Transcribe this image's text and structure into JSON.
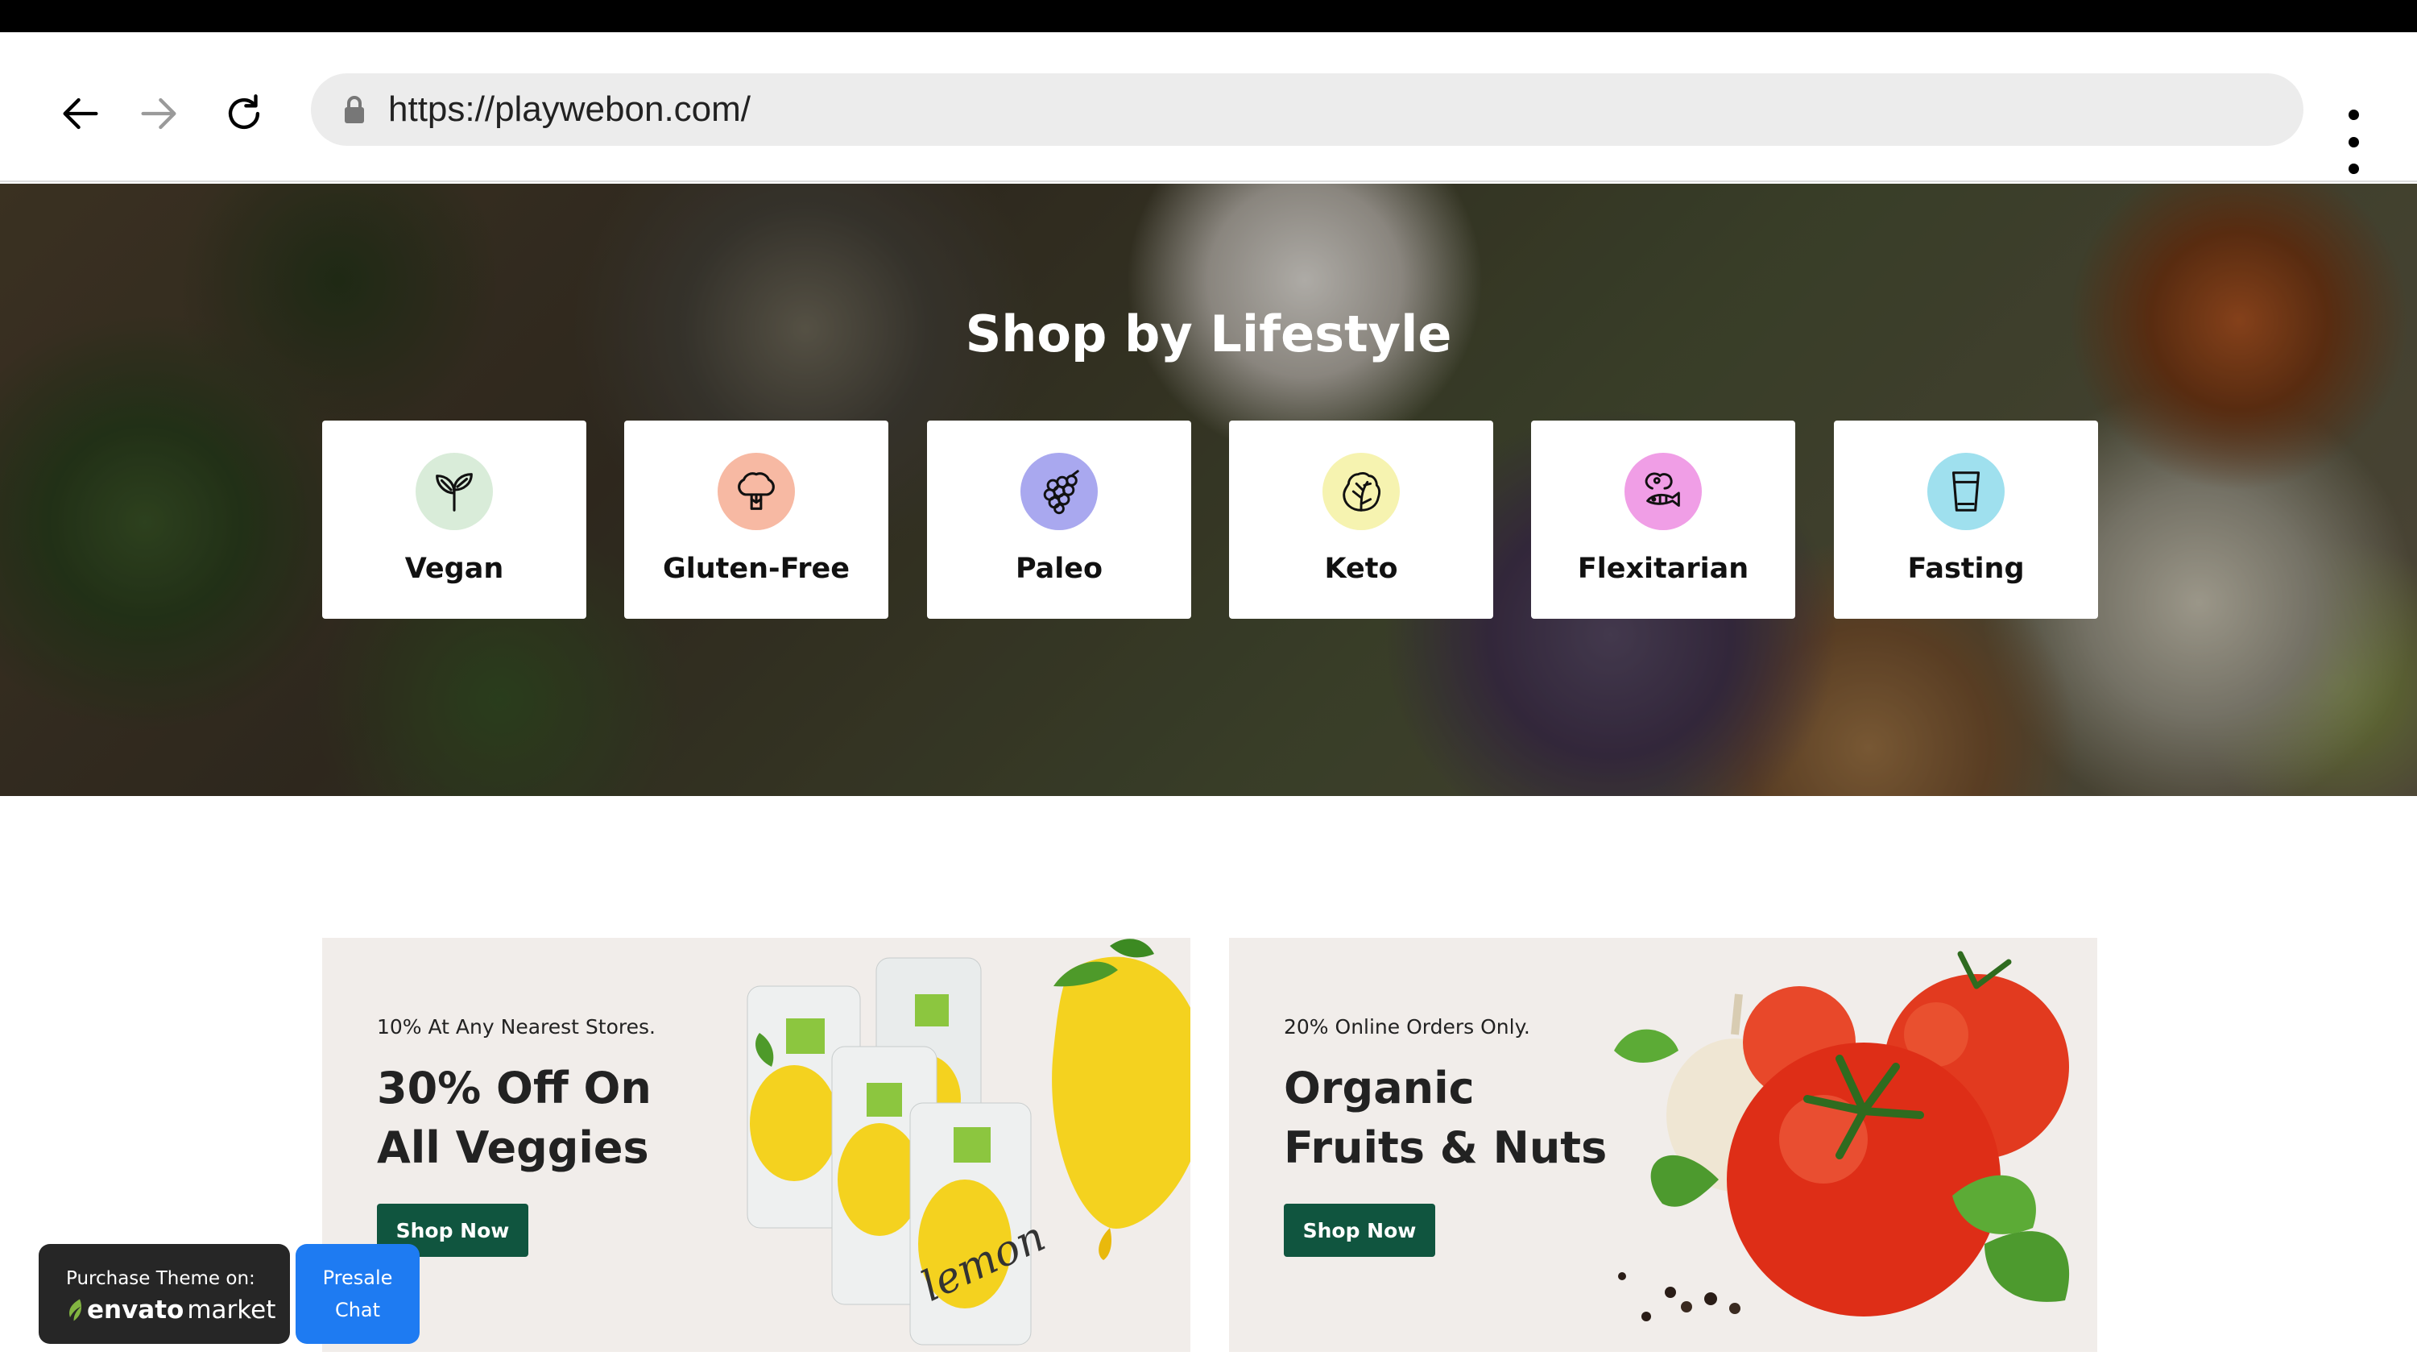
{
  "browser": {
    "url": "https://playwebon.com/",
    "icons": [
      "back-arrow-icon",
      "forward-arrow-icon",
      "reload-icon",
      "lock-icon",
      "more-vert-icon"
    ]
  },
  "hero": {
    "title": "Shop by Lifestyle",
    "categories": [
      {
        "label": "Vegan",
        "icon": "sprout-icon",
        "color": "#d9ecd9"
      },
      {
        "label": "Gluten-Free",
        "icon": "broccoli-icon",
        "color": "#f7b9a3"
      },
      {
        "label": "Paleo",
        "icon": "grapes-icon",
        "color": "#a9a8ef"
      },
      {
        "label": "Keto",
        "icon": "lettuce-icon",
        "color": "#f6f3b0"
      },
      {
        "label": "Flexitarian",
        "icon": "meat-fish-icon",
        "color": "#f09ee6"
      },
      {
        "label": "Fasting",
        "icon": "glass-icon",
        "color": "#9fe0ee"
      }
    ]
  },
  "banners": [
    {
      "small": "10% At Any Nearest Stores.",
      "title_line1": "30% Off On",
      "title_line2": "All Veggies",
      "button": "Shop Now",
      "art": "lemon-juice-cans"
    },
    {
      "small": "20% Online Orders Only.",
      "title_line1": "Organic",
      "title_line2": "Fruits & Nuts",
      "button": "Shop Now",
      "art": "tomatoes-garlic-basil"
    }
  ],
  "purchase": {
    "label": "Purchase Theme on:",
    "brand": "envato",
    "brand_suffix": "market"
  },
  "presale": {
    "line1": "Presale",
    "line2": "Chat"
  },
  "colors": {
    "button_green": "#10553f",
    "presale_blue": "#1e7bf2"
  }
}
